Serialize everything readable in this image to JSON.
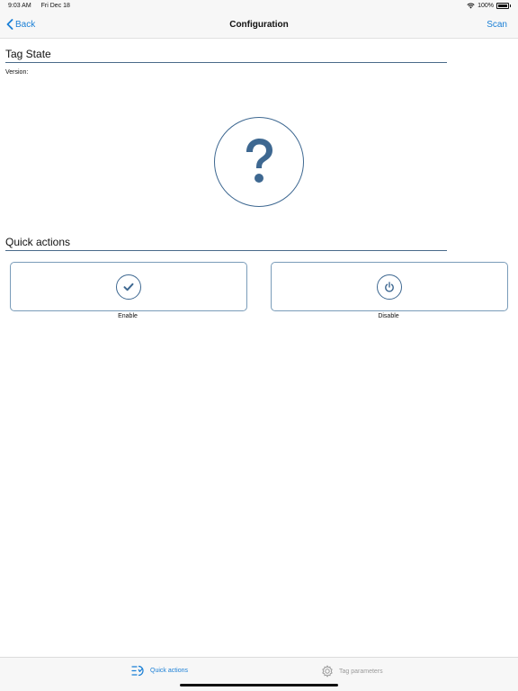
{
  "status_bar": {
    "time": "9:03 AM",
    "date": "Fri Dec 18",
    "battery": "100%",
    "wifi_icon": "wifi-icon",
    "battery_icon": "battery-icon"
  },
  "nav": {
    "back_label": "Back",
    "title": "Configuration",
    "action_label": "Scan",
    "back_icon": "chevron-left-icon"
  },
  "tag_state": {
    "title": "Tag State",
    "version_label": "Version:",
    "state_icon": "question-mark-icon"
  },
  "quick_actions": {
    "title": "Quick actions",
    "actions": [
      {
        "label": "Enable",
        "icon": "check-icon"
      },
      {
        "label": "Disable",
        "icon": "power-icon"
      }
    ]
  },
  "tab_bar": {
    "tabs": [
      {
        "label": "Quick actions",
        "icon": "quick-actions-icon",
        "active": true
      },
      {
        "label": "Tag parameters",
        "icon": "gear-icon",
        "active": false
      }
    ]
  },
  "colors": {
    "accent": "#1a7fd6",
    "icon_blue": "#3e6891",
    "rule": "#4a6b8a",
    "bar_bg": "#f7f7f7"
  }
}
